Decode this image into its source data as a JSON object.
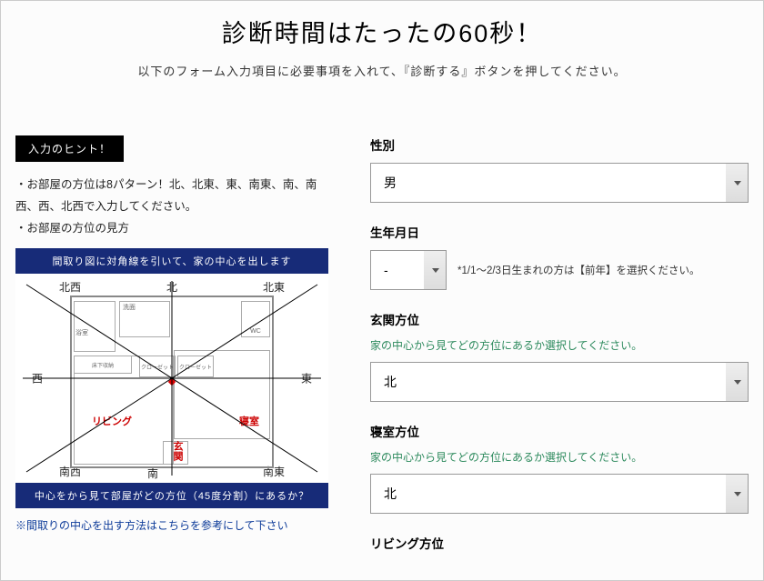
{
  "header": {
    "title": "診断時間はたったの60秒！",
    "subtitle": "以下のフォーム入力項目に必要事項を入れて、『診断する』ボタンを押してください。"
  },
  "hint": {
    "badge": "入力のヒント！",
    "line1": "・お部屋の方位は8パターン！北、北東、東、南東、南、南西、西、北西で入力してください。",
    "line2": "・お部屋の方位の見方"
  },
  "diagram": {
    "bar_top": "間取り図に対角線を引いて、家の中心を出します",
    "bar_bottom": "中心をから見て部屋がどの方位（45度分割）にあるか？",
    "dirs": {
      "n": "北",
      "s": "南",
      "e": "東",
      "w": "西",
      "ne": "北東",
      "nw": "北西",
      "se": "南東",
      "sw": "南西"
    },
    "rooms": {
      "living": "リビング",
      "bedroom": "寝室",
      "entrance": "玄関",
      "bath": "浴室",
      "wash": "洗面",
      "wc": "WC",
      "closet": "クローゼット",
      "kitchen": "床下収納"
    },
    "link_note": "※間取りの中心を出す方法はこちらを参考にして下さい"
  },
  "form": {
    "gender": {
      "label": "性別",
      "value": "男"
    },
    "birth": {
      "label": "生年月日",
      "value": "-",
      "note": "*1/1～2/3日生まれの方は【前年】を選択ください。"
    },
    "entrance": {
      "label": "玄関方位",
      "help": "家の中心から見てどの方位にあるか選択してください。",
      "value": "北"
    },
    "bedroom": {
      "label": "寝室方位",
      "help": "家の中心から見てどの方位にあるか選択してください。",
      "value": "北"
    },
    "living": {
      "label": "リビング方位"
    }
  }
}
